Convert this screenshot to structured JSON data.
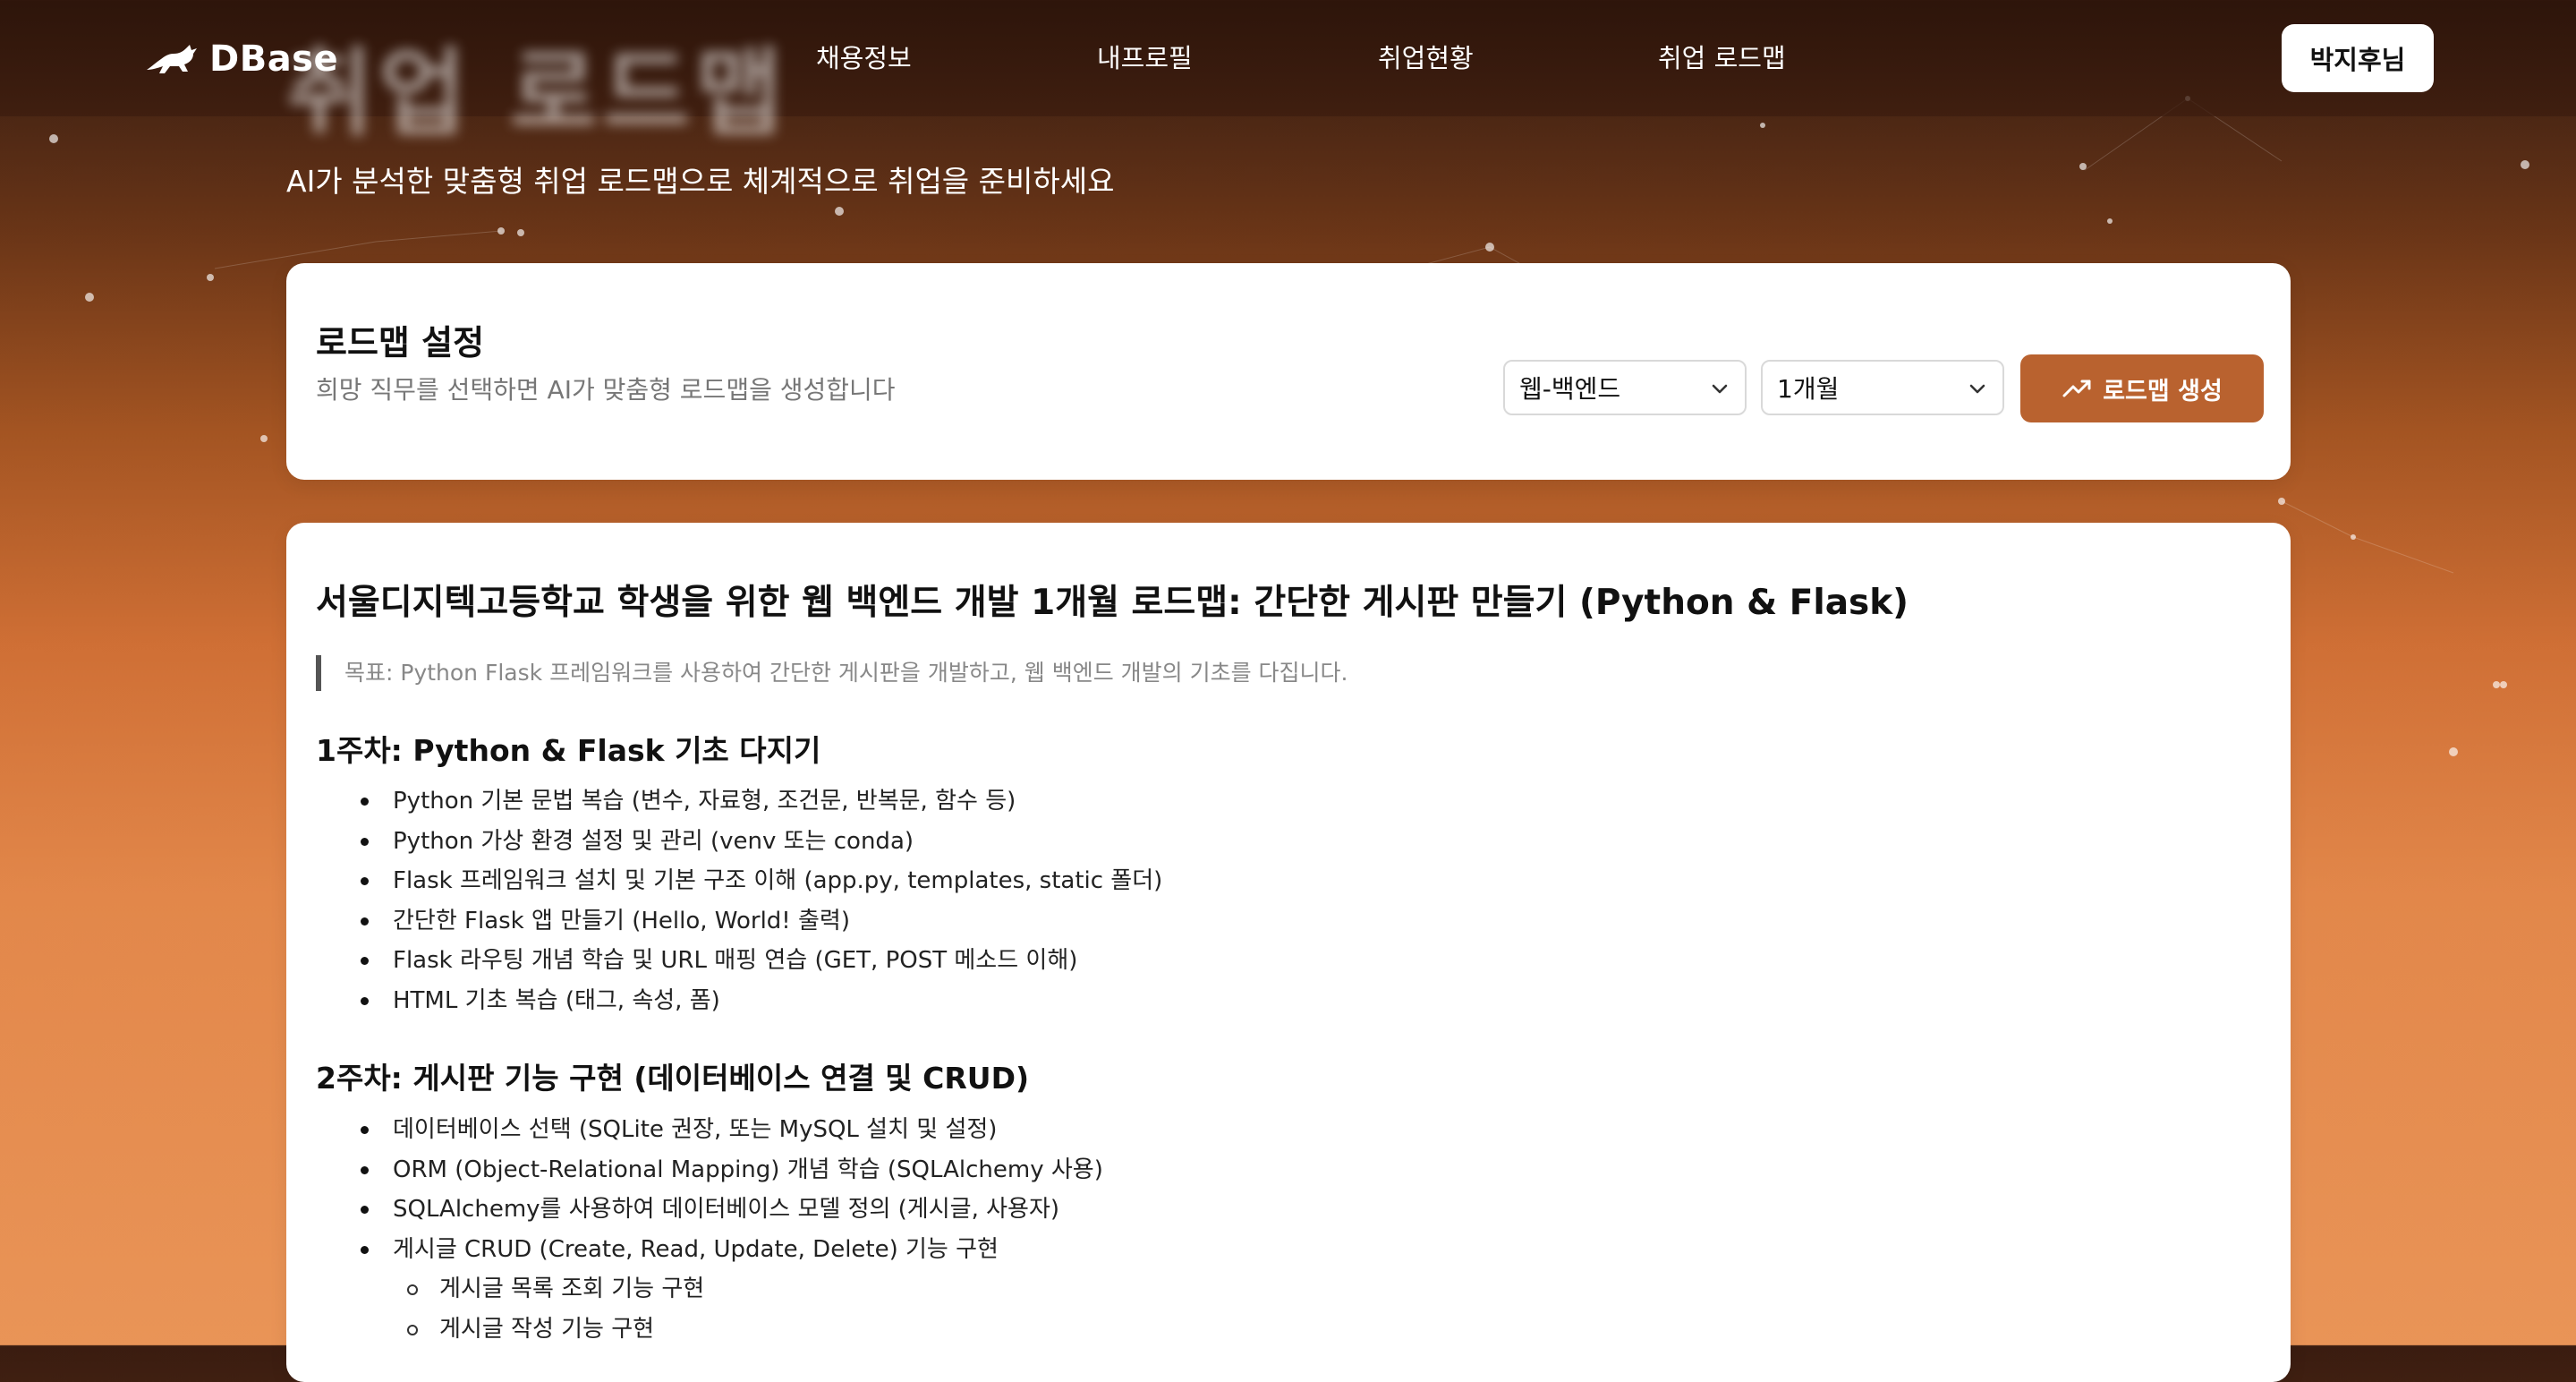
{
  "header": {
    "logo_text": "DBase",
    "hero_ghost_title": "취업 로드맵",
    "nav": [
      {
        "label": "채용정보"
      },
      {
        "label": "내프로필"
      },
      {
        "label": "취업현황"
      },
      {
        "label": "취업 로드맵"
      }
    ],
    "user_label": "박지후님"
  },
  "hero": {
    "subtitle": "AI가 분석한 맞춤형 취업 로드맵으로 체계적으로 취업을 준비하세요"
  },
  "settings": {
    "title": "로드맵 설정",
    "description": "희망 직무를 선택하면 AI가 맞춤형 로드맵을 생성합니다",
    "job_select_value": "웹-백엔드",
    "period_select_value": "1개월",
    "generate_label": "로드맵 생성"
  },
  "roadmap": {
    "title": "서울디지텍고등학교 학생을 위한 웹 백엔드 개발 1개월 로드맵: 간단한 게시판 만들기 (Python & Flask)",
    "goal": "목표: Python Flask 프레임워크를 사용하여 간단한 게시판을 개발하고, 웹 백엔드 개발의 기초를 다집니다.",
    "weeks": [
      {
        "title": "1주차: Python & Flask 기초 다지기",
        "items": [
          "Python 기본 문법 복습 (변수, 자료형, 조건문, 반복문, 함수 등)",
          "Python 가상 환경 설정 및 관리 (venv 또는 conda)",
          "Flask 프레임워크 설치 및 기본 구조 이해 (app.py, templates, static 폴더)",
          "간단한 Flask 앱 만들기 (Hello, World! 출력)",
          "Flask 라우팅 개념 학습 및 URL 매핑 연습 (GET, POST 메소드 이해)",
          "HTML 기초 복습 (태그, 속성, 폼)"
        ]
      },
      {
        "title": "2주차: 게시판 기능 구현 (데이터베이스 연결 및 CRUD)",
        "items": [
          "데이터베이스 선택 (SQLite 권장, 또는 MySQL 설치 및 설정)",
          "ORM (Object-Relational Mapping) 개념 학습 (SQLAlchemy 사용)",
          "SQLAlchemy를 사용하여 데이터베이스 모델 정의 (게시글, 사용자)",
          "게시글 CRUD (Create, Read, Update, Delete) 기능 구현"
        ],
        "sub_items": [
          "게시글 목록 조회 기능 구현",
          "게시글 작성 기능 구현"
        ]
      }
    ]
  },
  "colors": {
    "accent": "#b9622f",
    "header_bg": "#3a1c10",
    "bg_bottom": "#e99457"
  },
  "icons": {
    "logo": "running-cat-icon",
    "select_chevron": "chevron-down-icon",
    "generate": "trending-up-icon"
  }
}
